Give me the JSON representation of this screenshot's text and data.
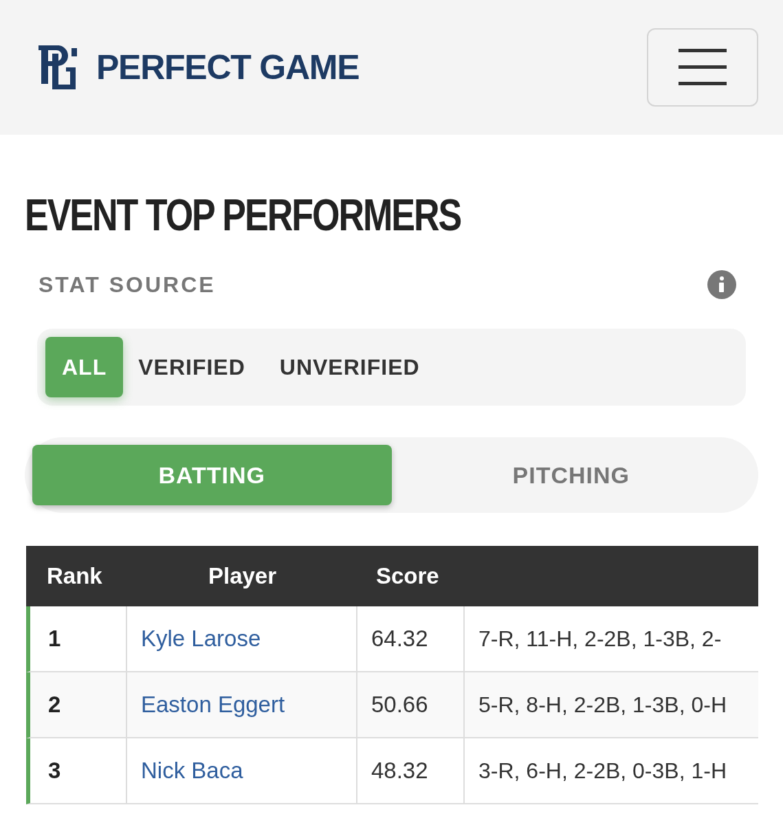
{
  "header": {
    "brand": "PERFECT GAME"
  },
  "title": "EVENT TOP PERFORMERS",
  "stat_source": {
    "label": "STAT SOURCE",
    "options": [
      {
        "label": "ALL",
        "selected": true
      },
      {
        "label": "VERIFIED",
        "selected": false
      },
      {
        "label": "UNVERIFIED",
        "selected": false
      }
    ]
  },
  "tabs": [
    {
      "label": "BATTING",
      "selected": true
    },
    {
      "label": "PITCHING",
      "selected": false
    }
  ],
  "table": {
    "columns": [
      "Rank",
      "Player",
      "Score"
    ],
    "rows": [
      {
        "rank": "1",
        "player": "Kyle Larose",
        "score": "64.32",
        "stats": "7-R, 11-H, 2-2B, 1-3B, 2-"
      },
      {
        "rank": "2",
        "player": "Easton Eggert",
        "score": "50.66",
        "stats": "5-R, 8-H, 2-2B, 1-3B, 0-H"
      },
      {
        "rank": "3",
        "player": "Nick Baca",
        "score": "48.32",
        "stats": "3-R, 6-H, 2-2B, 0-3B, 1-H"
      }
    ]
  }
}
